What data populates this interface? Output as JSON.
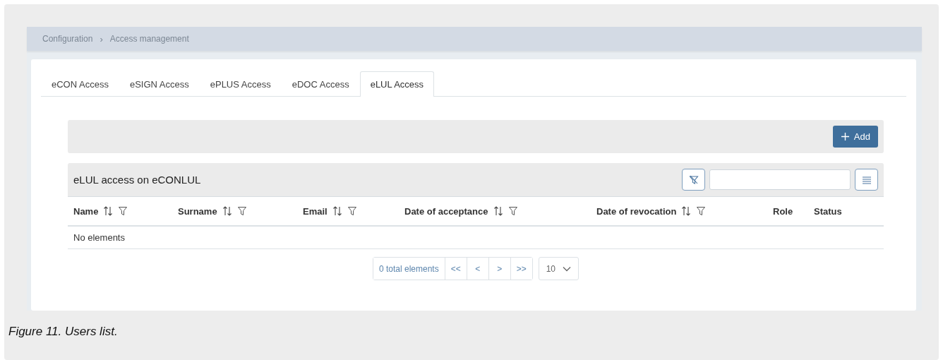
{
  "breadcrumb": [
    "Configuration",
    "Access management"
  ],
  "breadcrumb_separator": "›",
  "tabs": [
    {
      "label": "eCON Access",
      "selected": false
    },
    {
      "label": "eSIGN Access",
      "selected": false
    },
    {
      "label": "ePLUS Access",
      "selected": false
    },
    {
      "label": "eDOC Access",
      "selected": false
    },
    {
      "label": "eLUL Access",
      "selected": true
    }
  ],
  "toolbar": {
    "add_button": "Add"
  },
  "table": {
    "title": "eLUL access on eCONLUL",
    "columns": [
      {
        "label": "Name",
        "sortable": true,
        "filterable": true
      },
      {
        "label": "Surname",
        "sortable": true,
        "filterable": true
      },
      {
        "label": "Email",
        "sortable": true,
        "filterable": true
      },
      {
        "label": "Date of acceptance",
        "sortable": true,
        "filterable": true
      },
      {
        "label": "Date of revocation",
        "sortable": true,
        "filterable": true
      },
      {
        "label": "Role",
        "sortable": false,
        "filterable": false
      },
      {
        "label": "Status",
        "sortable": false,
        "filterable": false
      }
    ],
    "empty_message": "No elements"
  },
  "pagination": {
    "total": "0 total elements",
    "first": "<<",
    "prev": "<",
    "next": ">",
    "last": ">>",
    "page_size": "10"
  },
  "caption": "Figure 11. Users list."
}
